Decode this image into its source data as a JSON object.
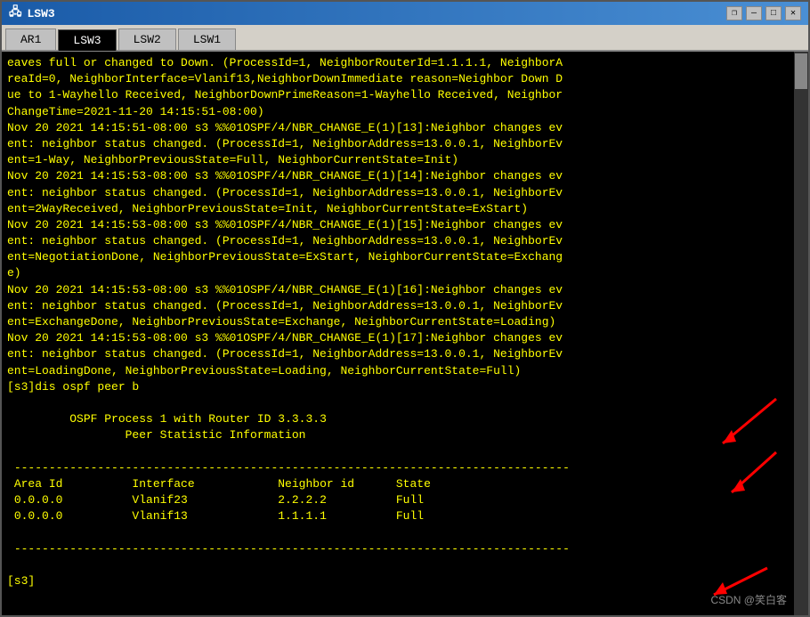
{
  "window": {
    "title": "LSW3",
    "icon": "network-switch-icon"
  },
  "tabs": [
    {
      "id": "ar1",
      "label": "AR1",
      "active": false
    },
    {
      "id": "lsw3",
      "label": "LSW3",
      "active": true
    },
    {
      "id": "lsw2",
      "label": "LSW2",
      "active": false
    },
    {
      "id": "lsw1",
      "label": "LSW1",
      "active": false
    }
  ],
  "title_controls": {
    "minimize": "—",
    "maximize": "□",
    "close": "✕",
    "restore": "❐"
  },
  "terminal": {
    "content": "eaves full or changed to Down. (ProcessId=1, NeighborRouterId=1.1.1.1, NeighborA\nreaId=0, NeighborInterface=Vlanif13,NeighborDownImmediate reason=Neighbor Down D\nue to 1-Wayhello Received, NeighborDownPrimeReason=1-Wayhello Received, Neighbor\nChangeTime=2021-11-20 14:15:51-08:00)\nNov 20 2021 14:15:51-08:00 s3 %%01OSPF/4/NBR_CHANGE_E(1)[13]:Neighbor changes ev\nent: neighbor status changed. (ProcessId=1, NeighborAddress=13.0.0.1, NeighborEv\nent=1-Way, NeighborPreviousState=Full, NeighborCurrentState=Init)\nNov 20 2021 14:15:53-08:00 s3 %%01OSPF/4/NBR_CHANGE_E(1)[14]:Neighbor changes ev\nent: neighbor status changed. (ProcessId=1, NeighborAddress=13.0.0.1, NeighborEv\nent=2WayReceived, NeighborPreviousState=Init, NeighborCurrentState=ExStart)\nNov 20 2021 14:15:53-08:00 s3 %%01OSPF/4/NBR_CHANGE_E(1)[15]:Neighbor changes ev\nent: neighbor status changed. (ProcessId=1, NeighborAddress=13.0.0.1, NeighborEv\nent=NegotiationDone, NeighborPreviousState=ExStart, NeighborCurrentState=Exchang\ne)\nNov 20 2021 14:15:53-08:00 s3 %%01OSPF/4/NBR_CHANGE_E(1)[16]:Neighbor changes ev\nent: neighbor status changed. (ProcessId=1, NeighborAddress=13.0.0.1, NeighborEv\nent=ExchangeDone, NeighborPreviousState=Exchange, NeighborCurrentState=Loading)\nNov 20 2021 14:15:53-08:00 s3 %%01OSPF/4/NBR_CHANGE_E(1)[17]:Neighbor changes ev\nent: neighbor status changed. (ProcessId=1, NeighborAddress=13.0.0.1, NeighborEv\nent=LoadingDone, NeighborPreviousState=Loading, NeighborCurrentState=Full)\n[s3]dis ospf peer b\n\n\t OSPF Process 1 with Router ID 3.3.3.3\n\t\t Peer Statistic Information\n\n --------------------------------------------------------------------------------\n Area Id          Interface            Neighbor id      State\n 0.0.0.0          Vlanif23             2.2.2.2          Full\n 0.0.0.0          Vlanif13             1.1.1.1          Full\n\n --------------------------------------------------------------------------------\n\n[s3]",
    "cursor": true
  },
  "watermark": "CSDN @笑白客"
}
